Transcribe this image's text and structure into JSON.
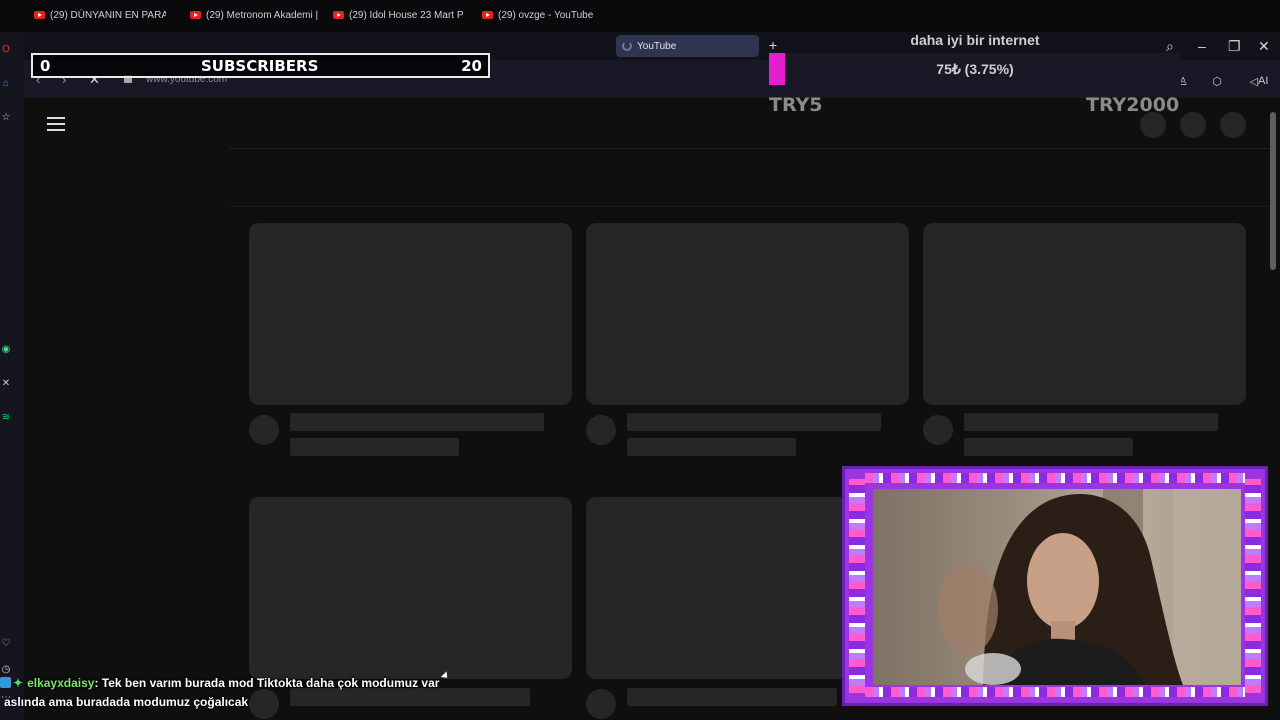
{
  "browser": {
    "tabs": [
      {
        "label": "(29) DÜNYANIN EN PARA",
        "icon": "youtube-icon"
      },
      {
        "label": "(29) Metronom Akademi |",
        "icon": "youtube-icon"
      },
      {
        "label": "(29) Idol House 23 Mart P",
        "icon": "youtube-icon"
      },
      {
        "label": "(29) ovzge - YouTube",
        "icon": "youtube-icon"
      },
      {
        "label": "YouTube",
        "icon": "loading-spinner-icon",
        "active": true
      }
    ],
    "url": "www.youtube.com",
    "ai_label": "AI"
  },
  "overlay": {
    "subscriber_goal": {
      "current": "0",
      "label": "SUBSCRIBERS",
      "target": "20"
    },
    "donation": {
      "title": "daha iyi bir internet",
      "progress_text": "75₺ (3.75%)",
      "progress_fraction": 0.0375,
      "min_label": "TRY5",
      "max_label": "TRY2000"
    }
  },
  "chat": {
    "user": "elkayxdaisy",
    "message_line1": ": Tek ben varım burada mod Tiktokta daha çok modumuz var",
    "message_line2": "aslında ama buradada modumuz çoğalıcak"
  },
  "colors": {
    "accent_magenta": "#e31fd0",
    "frame_purple": "#9a35e0",
    "username_green": "#7ce36b",
    "youtube_red": "#e62117"
  }
}
